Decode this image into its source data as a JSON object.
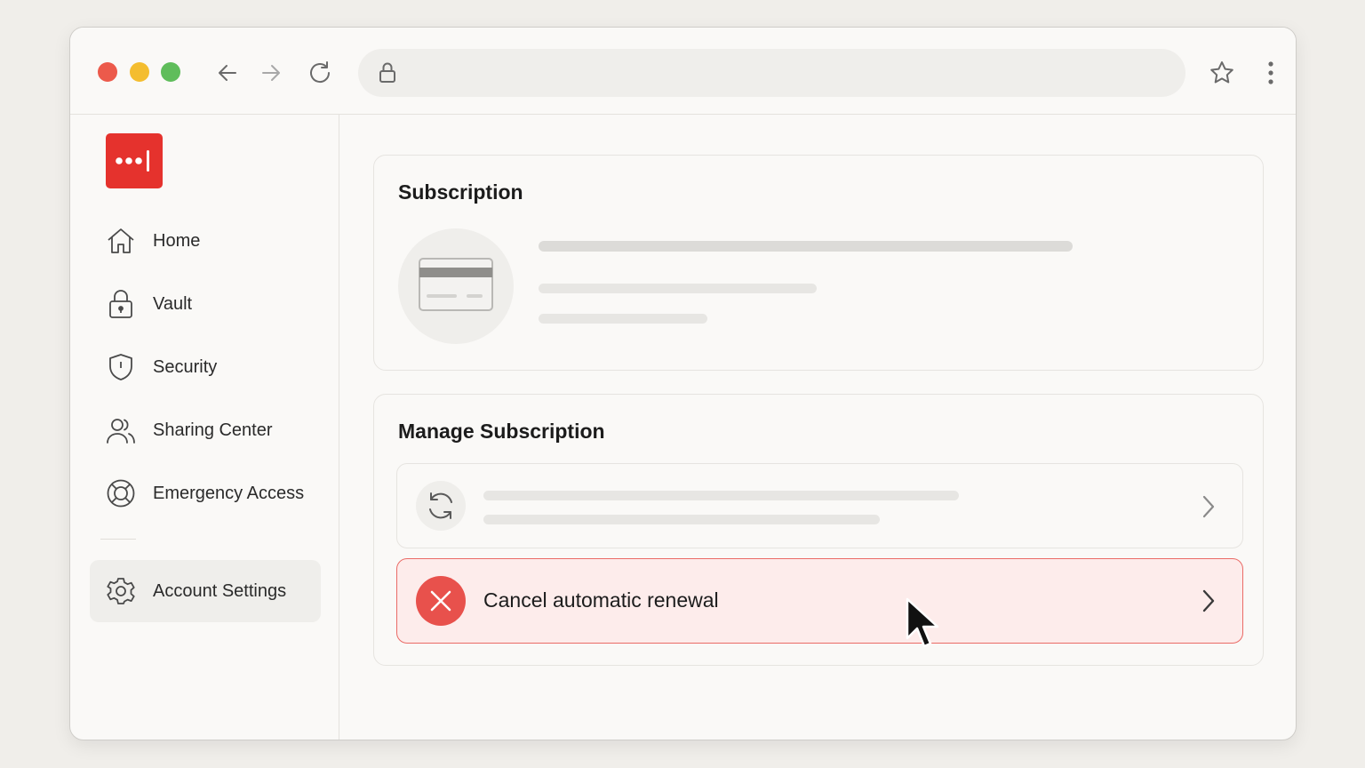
{
  "browser": {
    "url": "",
    "controls": [
      "back",
      "forward",
      "reload",
      "bookmark",
      "menu"
    ]
  },
  "sidebar": {
    "logo_icon": "password-manager-logo",
    "items": [
      {
        "label": "Home",
        "icon": "home-icon"
      },
      {
        "label": "Vault",
        "icon": "lock-icon"
      },
      {
        "label": "Security",
        "icon": "shield-icon"
      },
      {
        "label": "Sharing Center",
        "icon": "users-icon"
      },
      {
        "label": "Emergency Access",
        "icon": "lifebuoy-icon"
      },
      {
        "label": "Account Settings",
        "icon": "gear-icon",
        "active": true
      }
    ]
  },
  "subscription": {
    "title": "Subscription",
    "icon": "credit-card-icon"
  },
  "manage": {
    "title": "Manage Subscription",
    "rows": [
      {
        "label": "",
        "icon": "refresh-icon"
      },
      {
        "label": "Cancel automatic renewal",
        "icon": "close-icon"
      }
    ]
  },
  "colors": {
    "brand": "#e5322d",
    "danger": "#e8514c",
    "danger_bg": "#fdeceb"
  }
}
